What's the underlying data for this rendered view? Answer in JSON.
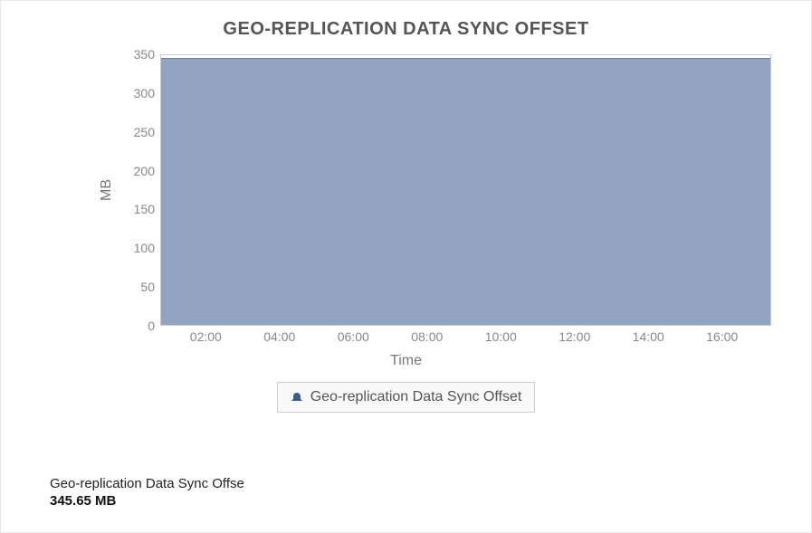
{
  "chart_data": {
    "type": "area",
    "title": "GEO-REPLICATION DATA SYNC OFFSET",
    "xlabel": "Time",
    "ylabel": "MB",
    "ylim": [
      0,
      350
    ],
    "y_ticks": [
      0,
      50,
      100,
      150,
      200,
      250,
      300,
      350
    ],
    "x_tick_labels": [
      "02:00",
      "04:00",
      "06:00",
      "08:00",
      "10:00",
      "12:00",
      "14:00",
      "16:00"
    ],
    "series": [
      {
        "name": "Geo-replication Data Sync Offset",
        "constant_value": 345.65
      }
    ]
  },
  "legend": {
    "label": "Geo-replication Data Sync Offset"
  },
  "summary": {
    "label": "Geo-replication Data Sync Offse",
    "value": "345.65 MB"
  },
  "colors": {
    "area_fill": "#92a4bf",
    "legend_icon": "#3c5b8e"
  }
}
